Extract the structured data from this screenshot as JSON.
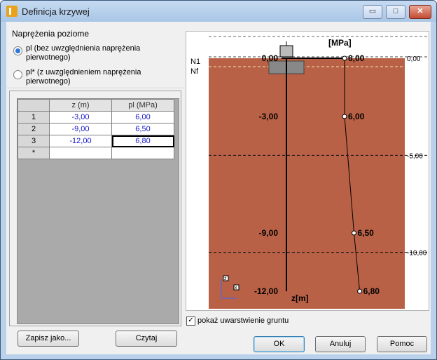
{
  "window": {
    "title": "Definicja krzywej",
    "controls": {
      "minimize": "▭",
      "maximize": "□",
      "close": "✕"
    }
  },
  "groupbox": {
    "title": "Naprężenia poziome",
    "options": [
      {
        "label": "pl (bez uwzględnienia naprężenia pierwotnego)",
        "checked": true
      },
      {
        "label": "pl* (z uwzględnieniem naprężenia pierwotnego)",
        "checked": false
      }
    ]
  },
  "table": {
    "headers": [
      "z (m)",
      "pl (MPa)"
    ],
    "rows": [
      {
        "n": "1",
        "z": "-3,00",
        "pl": "6,00"
      },
      {
        "n": "2",
        "z": "-9,00",
        "pl": "6,50"
      },
      {
        "n": "3",
        "z": "-12,00",
        "pl": "6,80"
      }
    ],
    "new_row_marker": "*"
  },
  "buttons": {
    "save_as": "Zapisz jako...",
    "read": "Czytaj",
    "ok": "OK",
    "cancel": "Anuluj",
    "help": "Pomoc"
  },
  "checkbox": {
    "label": "pokaż uwarstwienie gruntu",
    "checked": true,
    "mark": "✓"
  },
  "chart_data": {
    "type": "line",
    "unit_label": "[MPa]",
    "axis_label": "z[m]",
    "left_labels": [
      "N1",
      "Nf"
    ],
    "depth_labels": [
      "0,00",
      "-3,00",
      "-9,00",
      "-12,00"
    ],
    "right_scale_labels": [
      "0,00",
      "-5,00",
      "-10,00"
    ],
    "curve": [
      {
        "z": 0.0,
        "pl": 6.0,
        "label": "6,00"
      },
      {
        "z": -3.0,
        "pl": 6.0,
        "label": "6,00"
      },
      {
        "z": -9.0,
        "pl": 6.5,
        "label": "6,50"
      },
      {
        "z": -12.0,
        "pl": 6.8,
        "label": "6,80"
      }
    ],
    "colors": {
      "soil": "#b86146",
      "background": "#ffffff",
      "curve": "#000000"
    }
  }
}
